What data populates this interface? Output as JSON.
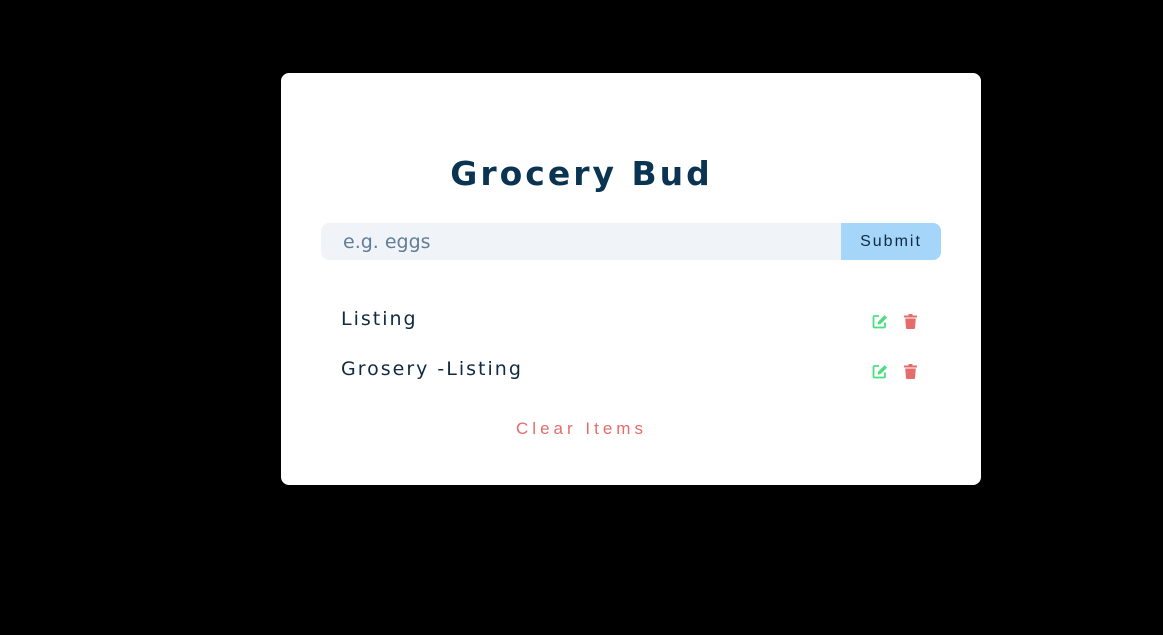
{
  "app": {
    "title": "Grocery Bud"
  },
  "form": {
    "placeholder": "e.g. eggs",
    "value": "",
    "submit_label": "Submit"
  },
  "list": {
    "items": [
      {
        "label": "Listing",
        "edit_icon": "edit-icon",
        "delete_icon": "trash-icon"
      },
      {
        "label": "Grosery -Listing",
        "edit_icon": "edit-icon",
        "delete_icon": "trash-icon"
      }
    ]
  },
  "clear_label": "Clear Items",
  "colors": {
    "background": "#000000",
    "card": "#ffffff",
    "title": "#0b3452",
    "input_bg": "#f0f4f8",
    "submit_bg": "#a5d5f8",
    "edit": "#4ade80",
    "delete": "#e66b6b",
    "clear": "#e66b6b"
  }
}
